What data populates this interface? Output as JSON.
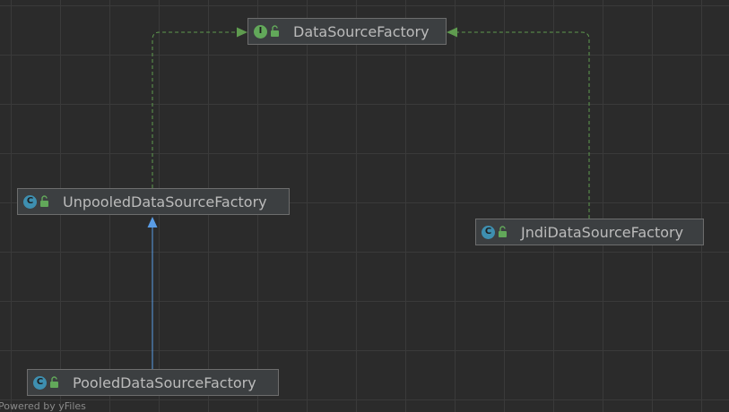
{
  "diagram": {
    "nodes": {
      "datasource_factory": {
        "label": "DataSourceFactory",
        "kind": "I",
        "icon": "interface-icon"
      },
      "unpooled": {
        "label": "UnpooledDataSourceFactory",
        "kind": "C",
        "icon": "class-icon"
      },
      "jndi": {
        "label": "JndiDataSourceFactory",
        "kind": "C",
        "icon": "class-icon"
      },
      "pooled": {
        "label": "PooledDataSourceFactory",
        "kind": "C",
        "icon": "class-icon"
      }
    },
    "edges": [
      {
        "from": "unpooled",
        "to": "datasource_factory",
        "type": "implements",
        "style": "dashed",
        "color": "#5f9b4f"
      },
      {
        "from": "jndi",
        "to": "datasource_factory",
        "type": "implements",
        "style": "dashed",
        "color": "#5f9b4f"
      },
      {
        "from": "pooled",
        "to": "unpooled",
        "type": "extends",
        "style": "solid",
        "color": "#5a9de6"
      }
    ]
  },
  "footer": {
    "text": "Powered by yFiles"
  },
  "colors": {
    "background": "#2b2b2b",
    "node_fill": "#3c3f41",
    "interface_badge": "#62a85a",
    "class_badge": "#3e8fb0",
    "implements_edge": "#5f9b4f",
    "extends_edge": "#5a9de6"
  }
}
